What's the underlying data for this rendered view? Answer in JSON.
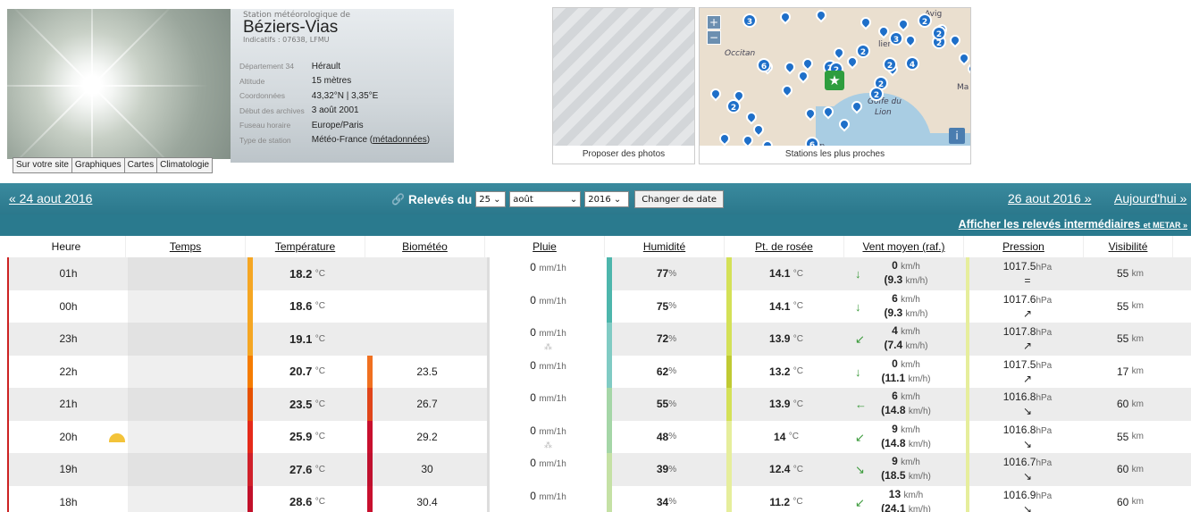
{
  "station": {
    "subtitle": "Station météorologique de",
    "name": "Béziers-Vias",
    "indicatifs": "Indicatifs : 07638, LFMU",
    "details": [
      {
        "key": "Département 34",
        "value": "Hérault"
      },
      {
        "key": "Altitude",
        "value": "15 mètres"
      },
      {
        "key": "Coordonnées",
        "value": "43,32°N | 3,35°E"
      },
      {
        "key": "Début des archives",
        "value": "3 août 2001"
      },
      {
        "key": "Fuseau horaire",
        "value": "Europe/Paris"
      },
      {
        "key": "Type de station",
        "value": "Météo-France (",
        "link": "métadonnées",
        "after": ")"
      }
    ]
  },
  "tabs": [
    "Sur votre site",
    "Graphiques",
    "Cartes",
    "Climatologie"
  ],
  "photo_label": "Proposer des photos",
  "map": {
    "label": "Stations les plus proches",
    "zoom_in": "+",
    "zoom_out": "−",
    "texts": [
      "Occitan",
      "Golfe du",
      "Lion",
      "Ma",
      "Perp",
      "Avig",
      "lier"
    ],
    "clusters": [
      "3",
      "2",
      "2",
      "3",
      "2",
      "4",
      "2",
      "2",
      "6",
      "2",
      "2",
      "2",
      "2",
      "2",
      "6"
    ],
    "info": "i"
  },
  "nav": {
    "prev": "« 24 aout 2016",
    "releves": "Relevés du",
    "day": "25",
    "month": "août",
    "year": "2016",
    "change": "Changer de date",
    "next": "26 aout 2016 »",
    "today": "Aujourd'hui »",
    "intermediaires": "Afficher les relevés intermédiaires",
    "metar": "et METAR »"
  },
  "columns": [
    "Heure",
    "Temps",
    "Température",
    "Biométéo",
    "Pluie",
    "Humidité",
    "Pt. de rosée",
    "Vent moyen (raf.)",
    "Pression",
    "Visibilité"
  ],
  "rows": [
    {
      "heure": "01h",
      "temp": "18.2",
      "temp_unit": "°C",
      "bio": "",
      "pluie": "0",
      "pluie_unit": "mm/1h",
      "hum": "77",
      "hum_unit": "%",
      "rosee": "14.1",
      "rosee_unit": "°C",
      "vent": "0",
      "vent_unit": "km/h",
      "raf": "(9.3",
      "raf_unit": "km/h)",
      "press": "1017.5",
      "press_unit": "hPa",
      "ptrend": "=",
      "vis": "55",
      "vis_unit": "km"
    },
    {
      "heure": "00h",
      "temp": "18.6",
      "temp_unit": "°C",
      "bio": "",
      "pluie": "0",
      "pluie_unit": "mm/1h",
      "hum": "75",
      "hum_unit": "%",
      "rosee": "14.1",
      "rosee_unit": "°C",
      "vent": "6",
      "vent_unit": "km/h",
      "raf": "(9.3",
      "raf_unit": "km/h)",
      "press": "1017.6",
      "press_unit": "hPa",
      "ptrend": "↗",
      "vis": "55",
      "vis_unit": "km"
    },
    {
      "heure": "23h",
      "temp": "19.1",
      "temp_unit": "°C",
      "bio": "",
      "pluie": "0",
      "pluie_unit": "mm/1h",
      "hum": "72",
      "hum_unit": "%",
      "rosee": "13.9",
      "rosee_unit": "°C",
      "vent": "4",
      "vent_unit": "km/h",
      "raf": "(7.4",
      "raf_unit": "km/h)",
      "press": "1017.8",
      "press_unit": "hPa",
      "ptrend": "↗",
      "vis": "55",
      "vis_unit": "km"
    },
    {
      "heure": "22h",
      "temp": "20.7",
      "temp_unit": "°C",
      "bio": "23.5",
      "pluie": "0",
      "pluie_unit": "mm/1h",
      "hum": "62",
      "hum_unit": "%",
      "rosee": "13.2",
      "rosee_unit": "°C",
      "vent": "0",
      "vent_unit": "km/h",
      "raf": "(11.1",
      "raf_unit": "km/h)",
      "press": "1017.5",
      "press_unit": "hPa",
      "ptrend": "↗",
      "vis": "17",
      "vis_unit": "km"
    },
    {
      "heure": "21h",
      "temp": "23.5",
      "temp_unit": "°C",
      "bio": "26.7",
      "pluie": "0",
      "pluie_unit": "mm/1h",
      "hum": "55",
      "hum_unit": "%",
      "rosee": "13.9",
      "rosee_unit": "°C",
      "vent": "6",
      "vent_unit": "km/h",
      "raf": "(14.8",
      "raf_unit": "km/h)",
      "press": "1016.8",
      "press_unit": "hPa",
      "ptrend": "↘",
      "vis": "60",
      "vis_unit": "km"
    },
    {
      "heure": "20h",
      "temp": "25.9",
      "temp_unit": "°C",
      "bio": "29.2",
      "pluie": "0",
      "pluie_unit": "mm/1h",
      "hum": "48",
      "hum_unit": "%",
      "rosee": "14",
      "rosee_unit": "°C",
      "vent": "9",
      "vent_unit": "km/h",
      "raf": "(14.8",
      "raf_unit": "km/h)",
      "press": "1016.8",
      "press_unit": "hPa",
      "ptrend": "↘",
      "vis": "55",
      "vis_unit": "km"
    },
    {
      "heure": "19h",
      "temp": "27.6",
      "temp_unit": "°C",
      "bio": "30",
      "pluie": "0",
      "pluie_unit": "mm/1h",
      "hum": "39",
      "hum_unit": "%",
      "rosee": "12.4",
      "rosee_unit": "°C",
      "vent": "9",
      "vent_unit": "km/h",
      "raf": "(18.5",
      "raf_unit": "km/h)",
      "press": "1016.7",
      "press_unit": "hPa",
      "ptrend": "↘",
      "vis": "60",
      "vis_unit": "km"
    },
    {
      "heure": "18h",
      "temp": "28.6",
      "temp_unit": "°C",
      "bio": "30.4",
      "pluie": "0",
      "pluie_unit": "mm/1h",
      "hum": "34",
      "hum_unit": "%",
      "rosee": "11.2",
      "rosee_unit": "°C",
      "vent": "13",
      "vent_unit": "km/h",
      "raf": "(24.1",
      "raf_unit": "km/h)",
      "press": "1016.9",
      "press_unit": "hPa",
      "ptrend": "↘",
      "vis": "60",
      "vis_unit": "km"
    }
  ],
  "colors": {
    "temp": [
      "#f5a623",
      "#f5a623",
      "#f5a623",
      "#f57c00",
      "#e65100",
      "#e52a1a",
      "#d0202a",
      "#c2102a"
    ],
    "bio": [
      "",
      "",
      "",
      "#f07020",
      "#e0451a",
      "#c8102e",
      "#c0102e",
      "#c8102e"
    ],
    "hum": [
      "#4db6ac",
      "#4db6ac",
      "#80cbc4",
      "#80cbc4",
      "#a5d6a7",
      "#a5d6a7",
      "#c5e1a5",
      "#c5e1a5"
    ],
    "rosee": [
      "#d4e157",
      "#d4e157",
      "#d4e157",
      "#c0ca33",
      "#d4e157",
      "#e6ee9c",
      "#e6ee9c",
      "#e6ee9c"
    ],
    "accent_nav": "#2b788c"
  }
}
